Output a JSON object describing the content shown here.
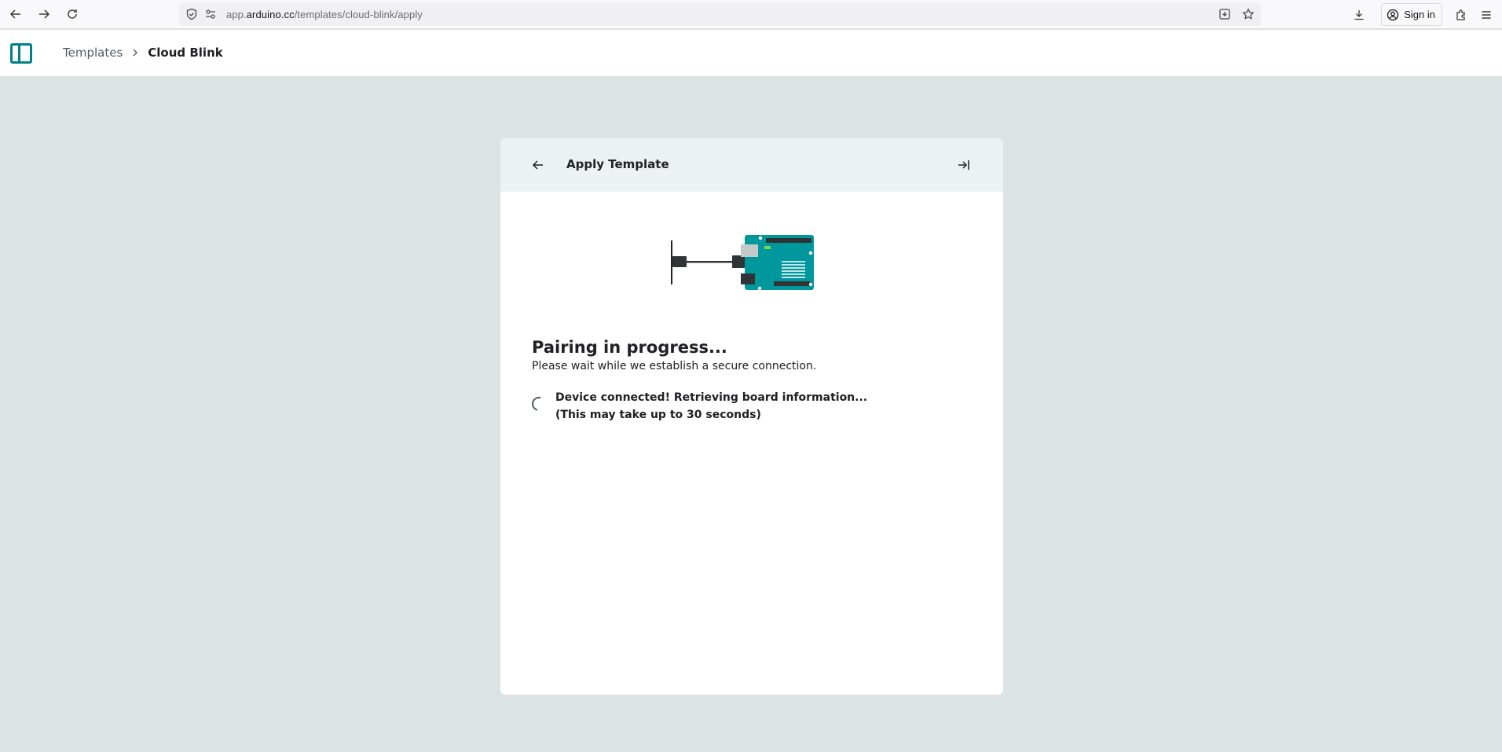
{
  "browser": {
    "url_prefix": "app.",
    "url_domain": "arduino.cc",
    "url_path": "/templates/cloud-blink/apply",
    "signin_label": "Sign in"
  },
  "header": {
    "breadcrumb_parent": "Templates",
    "breadcrumb_current": "Cloud Blink"
  },
  "card": {
    "title": "Apply Template",
    "pairing_title": "Pairing in progress...",
    "pairing_subtitle": "Please wait while we establish a secure connection.",
    "status_line1": "Device connected! Retrieving board information...",
    "status_line2": "(This may take up to 30 seconds)"
  },
  "colors": {
    "accent": "#008184",
    "board": "#00979d",
    "page_background": "#dbe3e3",
    "card_header": "#ecf1f1"
  }
}
